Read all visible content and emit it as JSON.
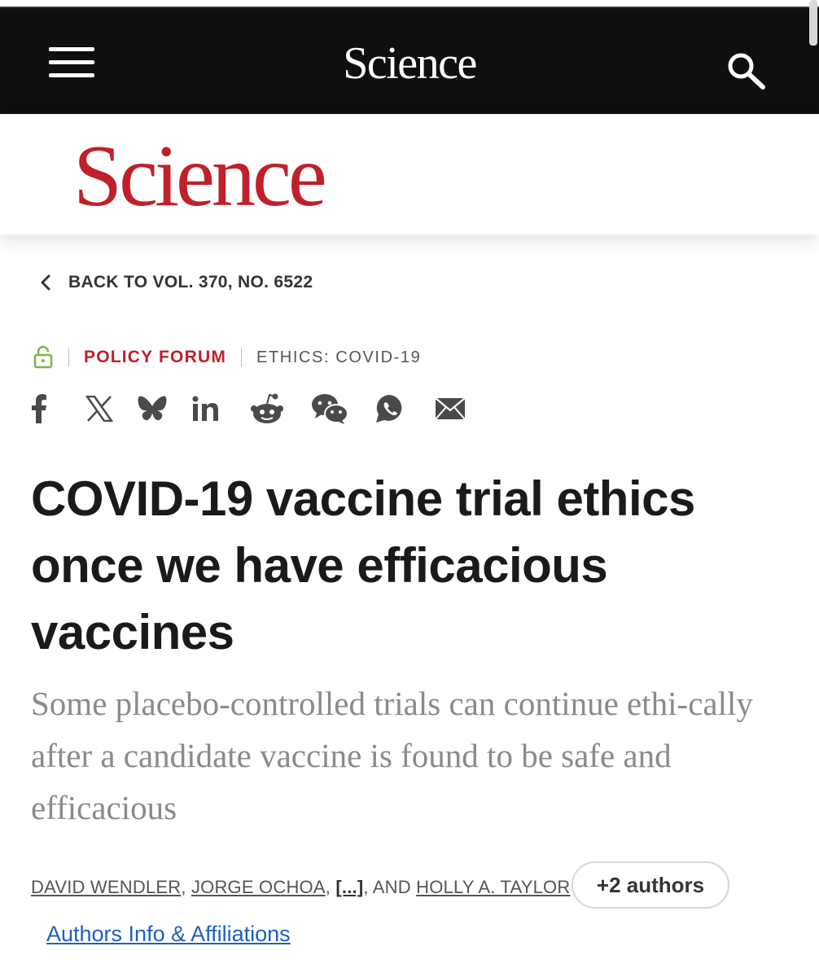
{
  "header": {
    "brand": "Science",
    "menu_icon": "hamburger-menu-icon",
    "search_icon": "search-icon",
    "background": "#0f0f0f"
  },
  "logo": {
    "text": "Science",
    "color": "#c0202a"
  },
  "breadcrumb": {
    "back_label": "BACK TO VOL. 370, NO. 6522",
    "icon": "chevron-left-icon"
  },
  "article_meta": {
    "access_icon": "open-access-lock-icon",
    "access_color": "#7ab648",
    "section": "POLICY FORUM",
    "topic": "ETHICS: COVID-19"
  },
  "share": {
    "items": [
      {
        "name": "facebook-icon"
      },
      {
        "name": "x-twitter-icon"
      },
      {
        "name": "bluesky-icon"
      },
      {
        "name": "linkedin-icon"
      },
      {
        "name": "reddit-icon"
      },
      {
        "name": "wechat-icon"
      },
      {
        "name": "whatsapp-icon"
      },
      {
        "name": "email-icon"
      }
    ],
    "icon_color": "#4a4a4a"
  },
  "article": {
    "title": "COVID-19 vaccine trial ethics once we have efficacious vaccines",
    "subtitle": "Some placebo-controlled trials can continue ethi-cally after a candidate vaccine is found to be safe and efficacious"
  },
  "authors": {
    "list": [
      "DAVID WENDLER",
      "JORGE OCHOA"
    ],
    "ellipsis": "[...]",
    "conjunction": ", AND",
    "last": "HOLLY A. TAYLOR",
    "more_button": "+2 authors",
    "affiliations_link": "Authors Info & Affiliations",
    "link_color": "#1f5fbf"
  }
}
